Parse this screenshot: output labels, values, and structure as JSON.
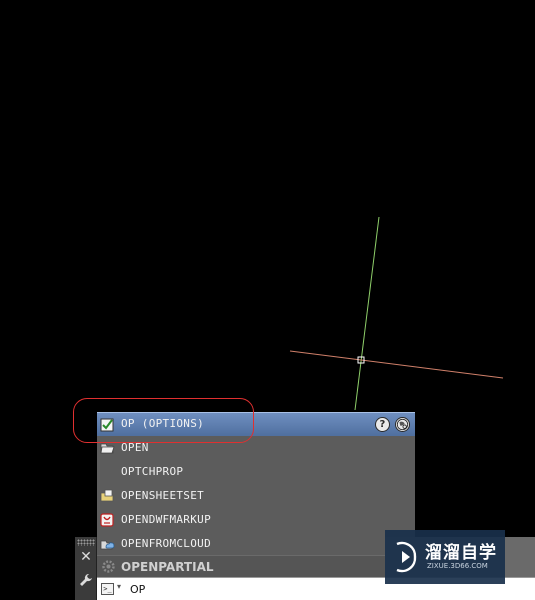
{
  "autocomplete": {
    "items": [
      {
        "label": "OP (OPTIONS)",
        "icon": "checkbox-options-icon",
        "selected": true
      },
      {
        "label": "OPEN",
        "icon": "open-folder-icon"
      },
      {
        "label": "OPTCHPROP",
        "icon": ""
      },
      {
        "label": "OPENSHEETSET",
        "icon": "sheet-set-icon"
      },
      {
        "label": "OPENDWFMARKUP",
        "icon": "dwf-markup-icon"
      },
      {
        "label": "OPENFROMCLOUD",
        "icon": "cloud-open-icon"
      }
    ],
    "help_button": "?",
    "search_button": "globe-search-icon"
  },
  "command_line": {
    "close_label": "✕",
    "history_label": "OPENPARTIAL",
    "prompt_glyph": ">_",
    "prompt_arrow": "▾",
    "input_value": "OP"
  },
  "watermark": {
    "name_cn": "溜溜自学",
    "url": "ZIXUE.3D66.COM"
  },
  "colors": {
    "canvas": "#000000",
    "y_axis": "#8fd06a",
    "x_axis": "#d0806a",
    "selection_blue": "#5a7aaa",
    "highlight_ring": "#e03030"
  }
}
